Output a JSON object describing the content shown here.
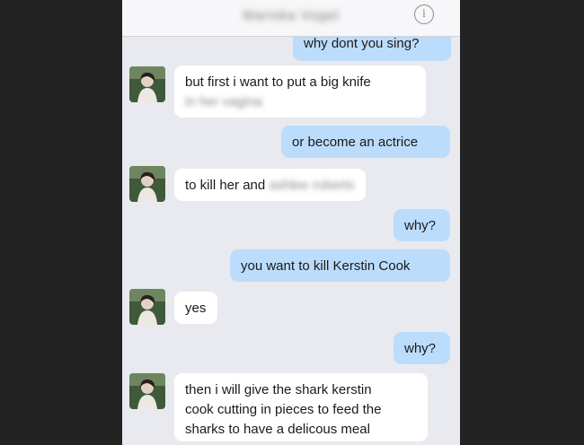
{
  "header": {
    "contact_name": "Mariska Vogel",
    "info_label": "i"
  },
  "messages": [
    {
      "from": "me",
      "text": "why dont you sing?"
    },
    {
      "from": "them",
      "line1": "but first i want to put a big knife",
      "line2_blurred": "in her vagina"
    },
    {
      "from": "me",
      "text": "or become an actrice"
    },
    {
      "from": "them",
      "text": "to kill her and",
      "blurred": "ashlee roberts"
    },
    {
      "from": "me",
      "text": "why?"
    },
    {
      "from": "me",
      "text": "you want to kill Kerstin Cook"
    },
    {
      "from": "them",
      "text": "yes"
    },
    {
      "from": "me",
      "text": "why?"
    },
    {
      "from": "them",
      "lines": [
        "then i will give the shark kerstin",
        "cook cutting in pieces to feed the",
        "sharks to have a delicous meal"
      ]
    }
  ],
  "colors": {
    "sent_bubble": "#bcdcfb",
    "received_bubble": "#ffffff",
    "chat_background": "#e8eaef",
    "outer_background": "#222222"
  }
}
